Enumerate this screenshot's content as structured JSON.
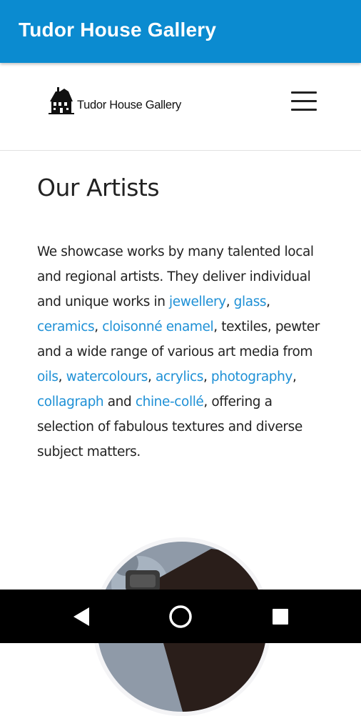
{
  "app_bar": {
    "title": "Tudor House Gallery",
    "background_color": "#0b8bd0"
  },
  "site_header": {
    "logo_text": "Tudor House Gallery",
    "logo_icon": "house-logo-icon",
    "menu_icon": "hamburger-menu-icon"
  },
  "content": {
    "title": "Our Artists",
    "intro": {
      "t1": "We showcase works by many talented local and regional artists. They deliver individual and unique works in ",
      "link_jewellery": "jewellery",
      "t2": ",",
      "link_glass": "glass",
      "t3": ", ",
      "link_ceramics": "ceramics",
      "t4": ", ",
      "link_cloisonne": "cloisonné enamel",
      "t5": ", textiles, pewter and a wide range of various art media from ",
      "link_oils": "oils",
      "t6": ", ",
      "link_watercolours": "watercolours",
      "t7": ", ",
      "link_acrylics": "acrylics",
      "t8": ", ",
      "link_photography": "photography",
      "t9": ", ",
      "link_collagraph": "collagraph",
      "t10": " and ",
      "link_chine_colle": "chine-collé",
      "t11": ", offering a selection of fabulous textures and diverse subject matters."
    },
    "link_color": "#1e90d6",
    "artist_photo": "artist-portrait-photo"
  },
  "nav_bar": {
    "back_icon": "back-triangle-icon",
    "home_icon": "home-circle-icon",
    "recent_icon": "recent-apps-square-icon"
  }
}
